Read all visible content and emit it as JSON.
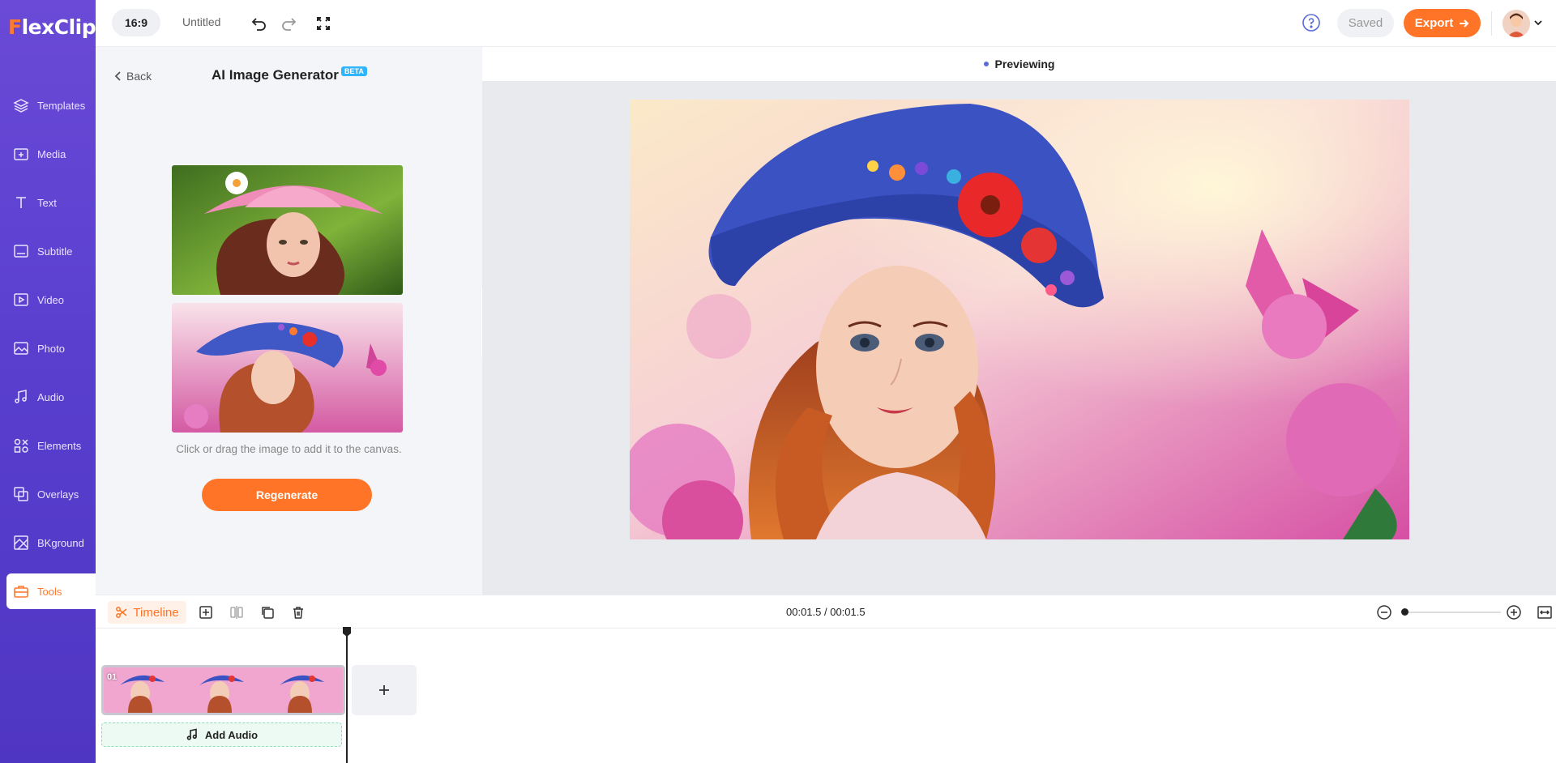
{
  "app": {
    "logo_text_f": "F",
    "logo_text_rest": "lexClip"
  },
  "sidebar": {
    "items": [
      {
        "label": "Templates",
        "icon": "layers-icon"
      },
      {
        "label": "Media",
        "icon": "folder-plus-icon"
      },
      {
        "label": "Text",
        "icon": "text-icon"
      },
      {
        "label": "Subtitle",
        "icon": "subtitle-icon"
      },
      {
        "label": "Video",
        "icon": "video-icon"
      },
      {
        "label": "Photo",
        "icon": "photo-icon"
      },
      {
        "label": "Audio",
        "icon": "music-note-icon"
      },
      {
        "label": "Elements",
        "icon": "shapes-icon"
      },
      {
        "label": "Overlays",
        "icon": "overlay-icon"
      },
      {
        "label": "BKground",
        "icon": "background-icon"
      },
      {
        "label": "Tools",
        "icon": "toolbox-icon",
        "active": true
      }
    ]
  },
  "topbar": {
    "aspect_ratio": "16:9",
    "project_title": "Untitled",
    "saved_label": "Saved",
    "export_label": "Export"
  },
  "tool_panel": {
    "back_label": "Back",
    "title": "AI Image Generator",
    "badge": "BETA",
    "hint": "Click or drag the image to add it to the canvas.",
    "regenerate_label": "Regenerate"
  },
  "preview": {
    "status": "Previewing"
  },
  "timeline": {
    "tab_label": "Timeline",
    "time_readout": "00:01.5 / 00:01.5",
    "clip_label": "01",
    "add_audio_label": "Add Audio",
    "zoom_level": 0
  },
  "colors": {
    "accent": "#ff7426",
    "sidebar": "#5a3fcf",
    "beta": "#2fb4ff",
    "preview_dot": "#5a6ad8"
  }
}
